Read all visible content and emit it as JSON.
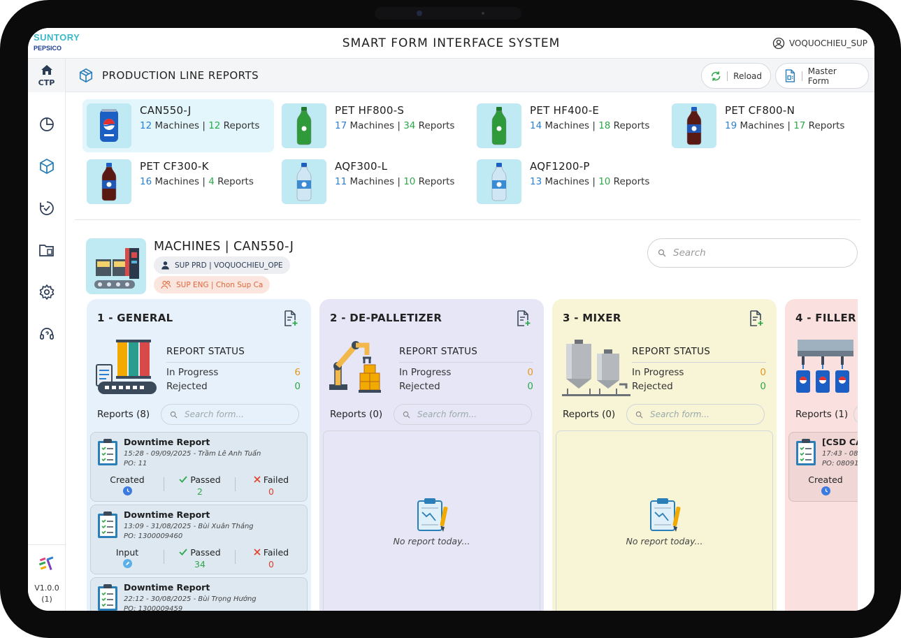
{
  "header": {
    "logo_top": "SUNTORY",
    "logo_bottom": "PEPSICO",
    "title": "SMART FORM INTERFACE SYSTEM",
    "username": "VOQUOCHIEU_SUP"
  },
  "nav": {
    "home_label": "CTP",
    "version": "V1.0.0",
    "build": "(1)",
    "icons": [
      "chart-pie-icon",
      "cube-icon",
      "history-check-icon",
      "folder-file-icon",
      "gear-icon",
      "support-headset-icon"
    ]
  },
  "section": {
    "title": "PRODUCTION LINE REPORTS",
    "reload_label": "Reload",
    "master_form_label": "Master Form"
  },
  "products": [
    {
      "name": "CAN550-J",
      "machines": "12",
      "reports": "12",
      "bottle": "can",
      "active": true
    },
    {
      "name": "PET HF800-S",
      "machines": "17",
      "reports": "34",
      "bottle": "green"
    },
    {
      "name": "PET HF400-E",
      "machines": "14",
      "reports": "18",
      "bottle": "green"
    },
    {
      "name": "PET CF800-N",
      "machines": "19",
      "reports": "17",
      "bottle": "cola"
    },
    {
      "name": "PET CF300-K",
      "machines": "16",
      "reports": "4",
      "bottle": "cola"
    },
    {
      "name": "AQF300-L",
      "machines": "11",
      "reports": "10",
      "bottle": "water"
    },
    {
      "name": "AQF1200-P",
      "machines": "13",
      "reports": "10",
      "bottle": "water"
    }
  ],
  "labels": {
    "machines": "Machines",
    "reports": "Reports",
    "sep": "|"
  },
  "machines": {
    "title": "MACHINES | CAN550-J",
    "sup_prd": "SUP PRD | VOQUOCHIEU_OPE",
    "sup_eng": "SUP ENG | Chon Sup Ca",
    "search_placeholder": "Search"
  },
  "columns": [
    {
      "title": "1 - GENERAL",
      "bg": "#e7f1fb",
      "status_heading": "REPORT STATUS",
      "in_progress_label": "In Progress",
      "in_progress": "6",
      "rejected_label": "Rejected",
      "rejected": "0",
      "reports_label": "Reports (8)",
      "search_placeholder": "Search form...",
      "reports": [
        {
          "title": "Downtime Report",
          "meta": "15:28 - 09/09/2025 - Trầm Lê Anh Tuấn",
          "po": "PO: 11",
          "state": "Created",
          "passed_label": "Passed",
          "passed": "2",
          "failed_label": "Failed",
          "failed": "0"
        },
        {
          "title": "Downtime Report",
          "meta": "13:09 - 31/08/2025 - Bùi Xuân Thắng",
          "po": "PO: 1300009460",
          "state": "Input",
          "passed_label": "Passed",
          "passed": "34",
          "failed_label": "Failed",
          "failed": "0"
        },
        {
          "title": "Downtime Report",
          "meta": "22:12 - 30/08/2025 - Bùi Trọng Hướng",
          "po": "PO: 1300009459"
        }
      ]
    },
    {
      "title": "2 - DE-PALLETIZER",
      "bg": "#e7e6f7",
      "status_heading": "REPORT STATUS",
      "in_progress_label": "In Progress",
      "in_progress": "0",
      "rejected_label": "Rejected",
      "rejected": "0",
      "reports_label": "Reports (0)",
      "search_placeholder": "Search form...",
      "empty_text": "No report today..."
    },
    {
      "title": "3 - MIXER",
      "bg": "#f8f4d6",
      "status_heading": "REPORT STATUS",
      "in_progress_label": "In Progress",
      "in_progress": "0",
      "rejected_label": "Rejected",
      "rejected": "0",
      "reports_label": "Reports (0)",
      "search_placeholder": "Search form...",
      "empty_text": "No report today..."
    },
    {
      "title": "4 - FILLER",
      "bg": "#fbe0e0",
      "reports_label": "Reports (1)",
      "reports": [
        {
          "title": "[CSD CA",
          "meta": "17:43 - 08/",
          "po": "PO: 08091",
          "state": "Created"
        }
      ]
    }
  ],
  "colors": {
    "blue": "#2a7fd0",
    "green": "#2ea84a",
    "orange": "#e8961e",
    "red": "#e0402b",
    "accent": "#3ab7c9"
  }
}
